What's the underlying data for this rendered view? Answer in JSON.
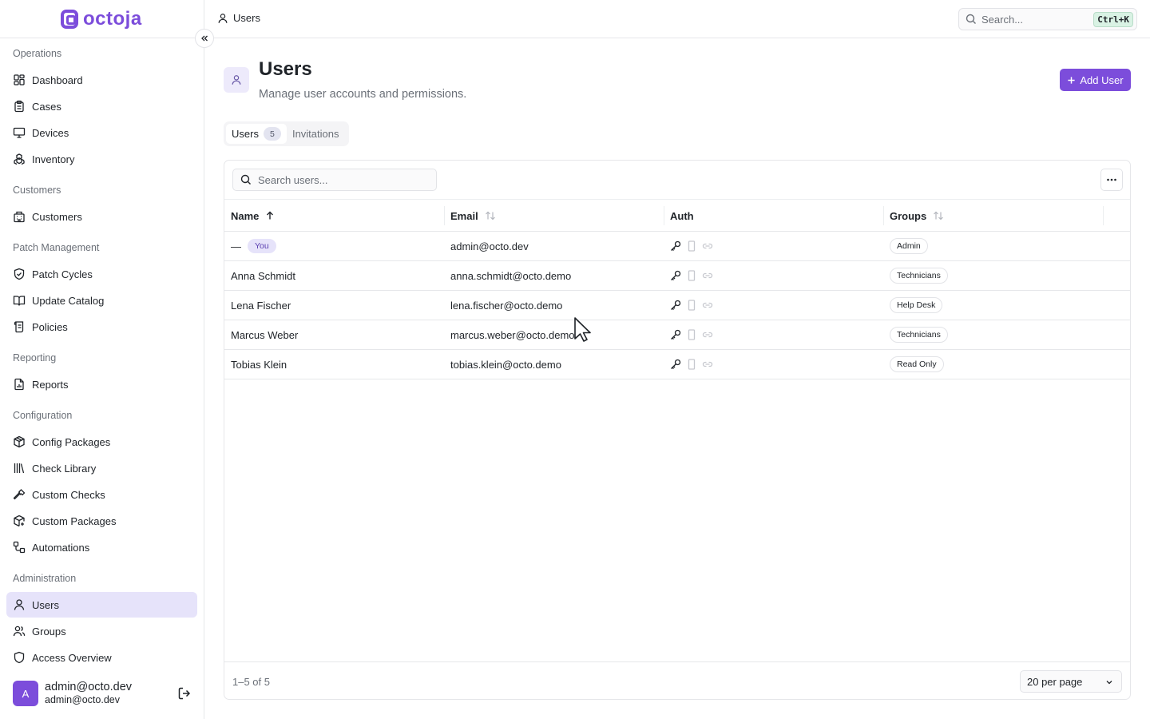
{
  "brand": {
    "name": "octoja",
    "accent": "#7c4ddb"
  },
  "sidebar": {
    "sections": [
      {
        "title": "Operations",
        "items": [
          {
            "label": "Dashboard",
            "icon": "dashboard-icon"
          },
          {
            "label": "Cases",
            "icon": "clipboard-icon"
          },
          {
            "label": "Devices",
            "icon": "monitor-icon"
          },
          {
            "label": "Inventory",
            "icon": "boxes-icon"
          }
        ]
      },
      {
        "title": "Customers",
        "items": [
          {
            "label": "Customers",
            "icon": "building-icon"
          }
        ]
      },
      {
        "title": "Patch Management",
        "items": [
          {
            "label": "Patch Cycles",
            "icon": "shield-check-icon"
          },
          {
            "label": "Update Catalog",
            "icon": "book-open-icon"
          },
          {
            "label": "Policies",
            "icon": "scroll-icon"
          }
        ]
      },
      {
        "title": "Reporting",
        "items": [
          {
            "label": "Reports",
            "icon": "file-chart-icon"
          }
        ]
      },
      {
        "title": "Configuration",
        "items": [
          {
            "label": "Config Packages",
            "icon": "package-icon"
          },
          {
            "label": "Check Library",
            "icon": "library-icon"
          },
          {
            "label": "Custom Checks",
            "icon": "hammer-icon"
          },
          {
            "label": "Custom Packages",
            "icon": "package-plus-icon"
          },
          {
            "label": "Automations",
            "icon": "workflow-icon"
          }
        ]
      },
      {
        "title": "Administration",
        "items": [
          {
            "label": "Users",
            "icon": "user-icon",
            "active": true
          },
          {
            "label": "Groups",
            "icon": "users-icon"
          },
          {
            "label": "Access Overview",
            "icon": "shield-icon"
          }
        ]
      }
    ],
    "user": {
      "initial": "A",
      "name": "admin@octo.dev",
      "email": "admin@octo.dev"
    }
  },
  "topbar": {
    "breadcrumb": "Users",
    "search_placeholder": "Search...",
    "shortcut": "Ctrl+K"
  },
  "page": {
    "title": "Users",
    "subtitle": "Manage user accounts and permissions.",
    "add_button": "Add User"
  },
  "tabs": [
    {
      "label": "Users",
      "count": "5",
      "active": true
    },
    {
      "label": "Invitations"
    }
  ],
  "table": {
    "search_placeholder": "Search users...",
    "columns": [
      "Name",
      "Email",
      "Auth",
      "Groups"
    ],
    "rows": [
      {
        "name": "—",
        "you": "You",
        "email": "admin@octo.dev",
        "group": "Admin"
      },
      {
        "name": "Anna Schmidt",
        "email": "anna.schmidt@octo.demo",
        "group": "Technicians"
      },
      {
        "name": "Lena Fischer",
        "email": "lena.fischer@octo.demo",
        "group": "Help Desk"
      },
      {
        "name": "Marcus Weber",
        "email": "marcus.weber@octo.demo",
        "group": "Technicians"
      },
      {
        "name": "Tobias Klein",
        "email": "tobias.klein@octo.demo",
        "group": "Read Only"
      }
    ],
    "range": "1–5 of 5",
    "per_page": "20 per page"
  }
}
